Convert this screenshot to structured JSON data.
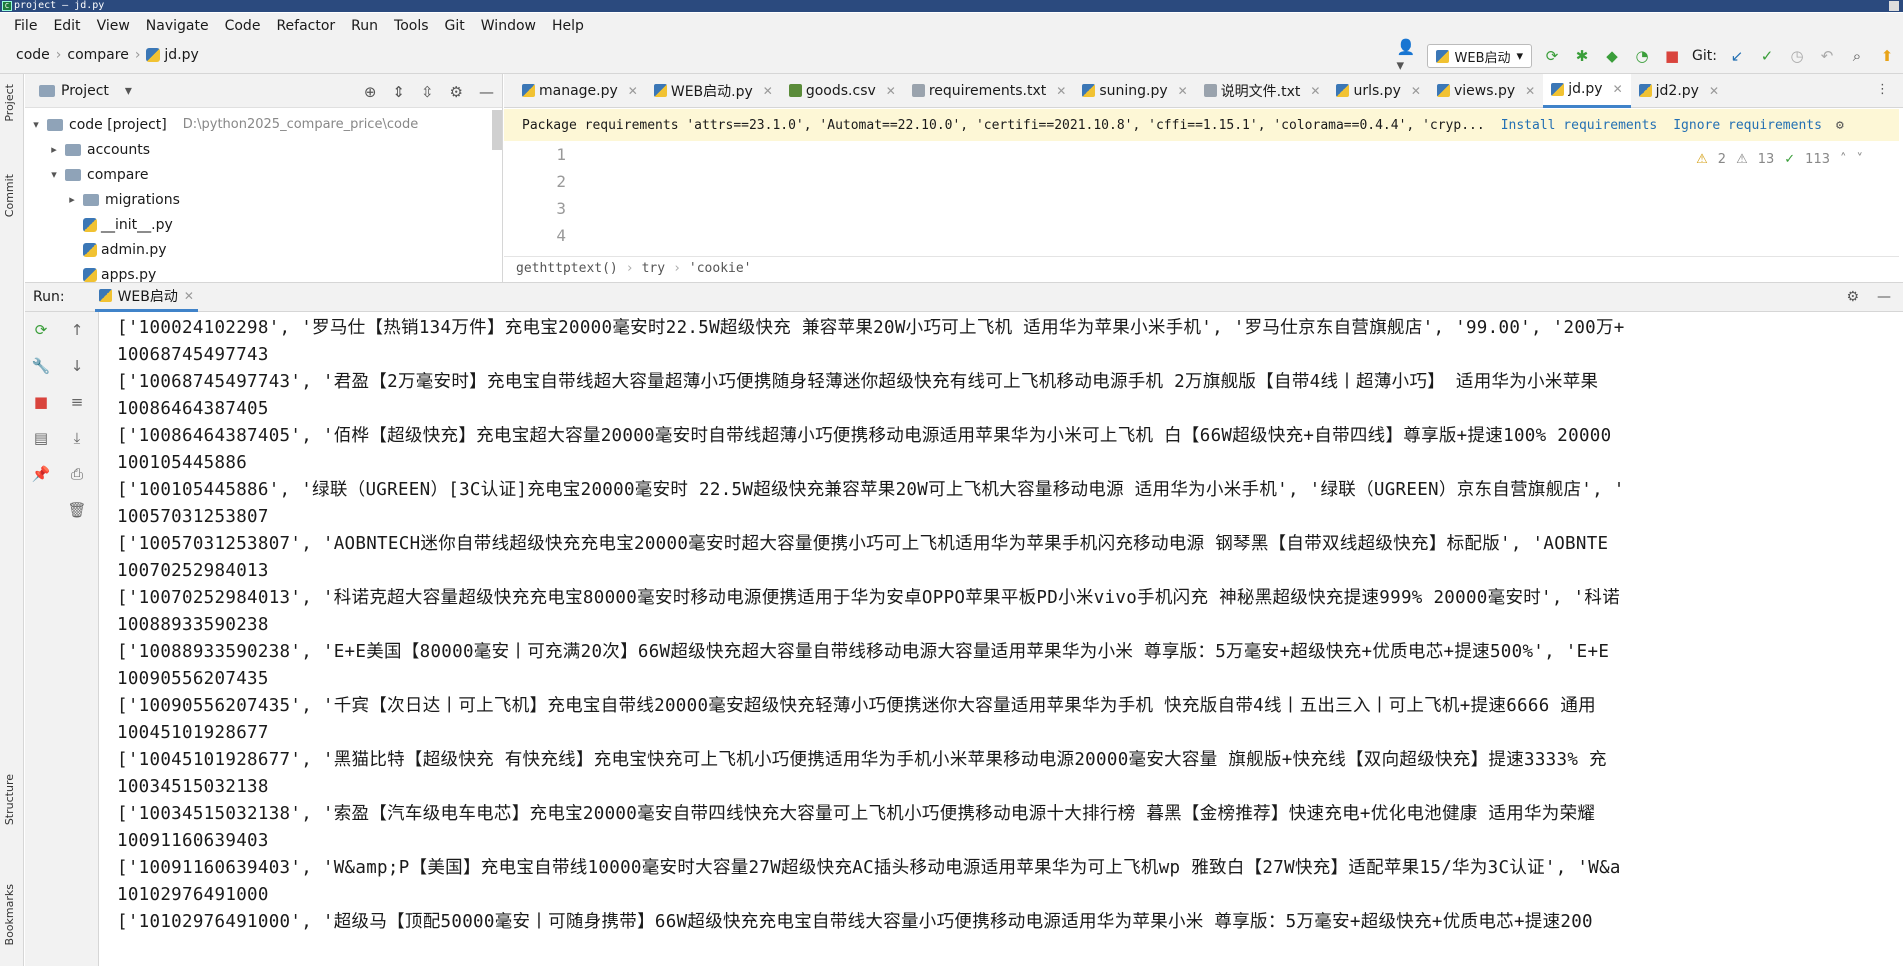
{
  "window": {
    "title": "project – jd.py"
  },
  "menu": [
    "File",
    "Edit",
    "View",
    "Navigate",
    "Code",
    "Refactor",
    "Run",
    "Tools",
    "Git",
    "Window",
    "Help"
  ],
  "breadcrumbs": [
    "code",
    "compare",
    "jd.py"
  ],
  "toolbar": {
    "run_config": "WEB启动",
    "git_label": "Git:"
  },
  "left_strip": {
    "project": "Project",
    "commit": "Commit",
    "structure": "Structure",
    "bookmarks": "Bookmarks"
  },
  "project_panel": {
    "title": "Project",
    "root": {
      "name": "code [project]",
      "path": "D:\\python2025_compare_price\\code"
    },
    "items": [
      {
        "name": "accounts",
        "type": "folder"
      },
      {
        "name": "compare",
        "type": "folder"
      },
      {
        "name": "migrations",
        "type": "folder"
      },
      {
        "name": "__init__.py",
        "type": "file"
      },
      {
        "name": "admin.py",
        "type": "file"
      },
      {
        "name": "apps.py",
        "type": "file"
      }
    ]
  },
  "tabs": [
    {
      "label": "manage.py",
      "icon": "py"
    },
    {
      "label": "WEB启动.py",
      "icon": "py"
    },
    {
      "label": "goods.csv",
      "icon": "csv"
    },
    {
      "label": "requirements.txt",
      "icon": "txt"
    },
    {
      "label": "suning.py",
      "icon": "py"
    },
    {
      "label": "说明文件.txt",
      "icon": "txt"
    },
    {
      "label": "urls.py",
      "icon": "py"
    },
    {
      "label": "views.py",
      "icon": "py"
    },
    {
      "label": "jd.py",
      "icon": "py",
      "active": true
    },
    {
      "label": "jd2.py",
      "icon": "py"
    }
  ],
  "banner": {
    "message": "Package requirements 'attrs==23.1.0', 'Automat==22.10.0', 'certifi==2021.10.8', 'cffi==1.15.1', 'colorama==0.4.4', 'cryp...",
    "install": "Install requirements",
    "ignore": "Ignore requirements"
  },
  "line_numbers": [
    "1",
    "2",
    "3",
    "4"
  ],
  "inspections": {
    "warnings": "2",
    "weak": "13",
    "ok": "113"
  },
  "editor_breadcrumb": [
    "gethttptext()",
    "try",
    "'cookie'"
  ],
  "run": {
    "label": "Run:",
    "tab": "WEB启动"
  },
  "console_lines": [
    "['100024102298', '罗马仕【热销134万件】充电宝20000毫安时22.5W超级快充 兼容苹果20W小巧可上飞机 适用华为苹果小米手机', '罗马仕京东自营旗舰店', '99.00', '200万+",
    "10068745497743",
    "['10068745497743', '君盈【2万毫安时】充电宝自带线超大容量超薄小巧便携随身轻薄迷你超级快充有线可上飞机移动电源手机 2万旗舰版【自带4线丨超薄小巧】 适用华为小米苹果",
    "10086464387405",
    "['10086464387405', '佰桦【超级快充】充电宝超大容量20000毫安时自带线超薄小巧便携移动电源适用苹果华为小米可上飞机 白【66W超级快充+自带四线】尊享版+提速100% 20000",
    "100105445886",
    "['100105445886', '绿联（UGREEN）[3C认证]充电宝20000毫安时 22.5W超级快充兼容苹果20W可上飞机大容量移动电源 适用华为小米手机', '绿联（UGREEN）京东自营旗舰店', '",
    "10057031253807",
    "['10057031253807', 'AOBNTECH迷你自带线超级快充充电宝20000毫安时超大容量便携小巧可上飞机适用华为苹果手机闪充移动电源 钢琴黑【自带双线超级快充】标配版', 'AOBNTE",
    "10070252984013",
    "['10070252984013', '科诺克超大容量超级快充充电宝80000毫安时移动电源便携适用于华为安卓OPPO苹果平板PD小米vivo手机闪充 神秘黑超级快充提速999% 20000毫安时', '科诺",
    "10088933590238",
    "['10088933590238', 'E+E美国【80000毫安丨可充满20次】66W超级快充超大容量自带线移动电源大容量适用苹果华为小米 尊享版：5万毫安+超级快充+优质电芯+提速500%', 'E+E",
    "10090556207435",
    "['10090556207435', '千宾【次日达丨可上飞机】充电宝自带线20000毫安超级快充轻薄小巧便携迷你大容量适用苹果华为手机 快充版自带4线丨五出三入丨可上飞机+提速6666 通用",
    "10045101928677",
    "['10045101928677', '黑猫比特【超级快充 有快充线】充电宝快充可上飞机小巧便携适用华为手机小米苹果移动电源20000毫安大容量 旗舰版+快充线【双向超级快充】提速3333% 充",
    "10034515032138",
    "['10034515032138', '索盈【汽车级电车电芯】充电宝20000毫安自带四线快充大容量可上飞机小巧便携移动电源十大排行榜 暮黑【金榜推荐】快速充电+优化电池健康 适用华为荣耀",
    "10091160639403",
    "['10091160639403', 'W&amp;P【美国】充电宝自带线10000毫安时大容量27W超级快充AC插头移动电源适用苹果华为可上飞机wp 雅致白【27W快充】适配苹果15/华为3C认证', 'W&a",
    "10102976491000",
    "['10102976491000', '超级马【顶配50000毫安丨可随身携带】66W超级快充充电宝自带线大容量小巧便携移动电源适用华为苹果小米 尊享版：5万毫安+超级快充+优质电芯+提速200"
  ]
}
